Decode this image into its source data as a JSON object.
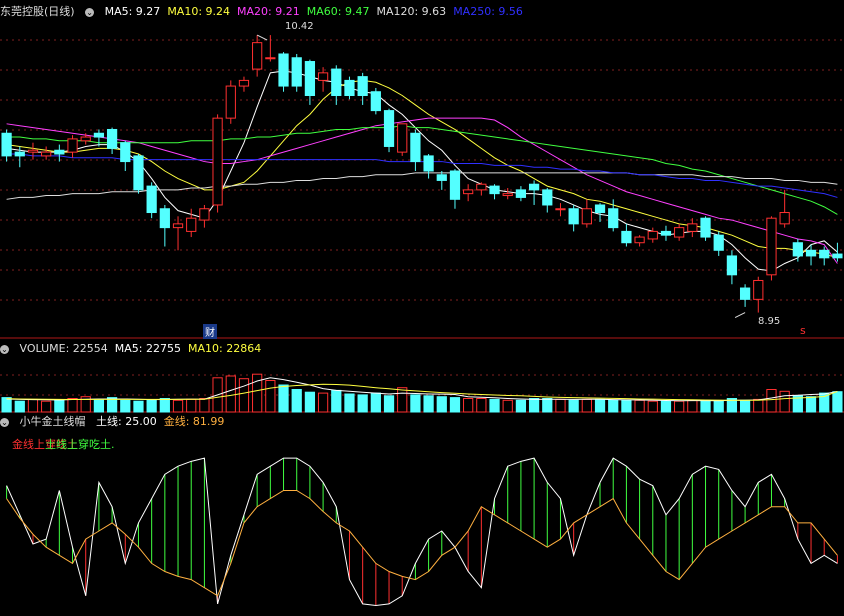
{
  "main": {
    "title": "东莞控股(日线)",
    "ma": [
      {
        "label": "MA5: 9.27",
        "color": "#ffffff"
      },
      {
        "label": "MA10: 9.24",
        "color": "#ffff40"
      },
      {
        "label": "MA20: 9.21",
        "color": "#ff40ff"
      },
      {
        "label": "MA60: 9.47",
        "color": "#40ff40"
      },
      {
        "label": "MA120: 9.63",
        "color": "#dddddd"
      },
      {
        "label": "MA250: 9.56",
        "color": "#3030ff"
      }
    ],
    "high_label": "10.42",
    "low_label": "8.95",
    "fin_badge": "财",
    "marker_s": "s"
  },
  "volume_panel": {
    "labels": [
      {
        "label": "VOLUME: 22554",
        "color": "#dddddd"
      },
      {
        "label": "MA5: 22755",
        "color": "#ffffff"
      },
      {
        "label": "MA10: 22864",
        "color": "#ffff40"
      }
    ]
  },
  "indicator_panel": {
    "name": "小牛金土线帽",
    "labels": [
      {
        "label": "土线: 25.00",
        "color": "#ffffff"
      },
      {
        "label": "金线: 81.99",
        "color": "#ffb040"
      }
    ],
    "signal_red": "金线上穿吃土",
    "signal_green": "土线上穿吃土."
  },
  "chart_data": {
    "type": "candlestick",
    "price_range": [
      8.9,
      10.5
    ],
    "candles": [
      [
        9.9,
        9.78,
        9.92,
        9.75
      ],
      [
        9.8,
        9.78,
        9.83,
        9.72
      ],
      [
        9.8,
        9.81,
        9.85,
        9.76
      ],
      [
        9.78,
        9.8,
        9.83,
        9.76
      ],
      [
        9.81,
        9.79,
        9.84,
        9.75
      ],
      [
        9.8,
        9.87,
        9.89,
        9.77
      ],
      [
        9.86,
        9.88,
        9.9,
        9.84
      ],
      [
        9.9,
        9.88,
        9.92,
        9.83
      ],
      [
        9.92,
        9.82,
        9.93,
        9.79
      ],
      [
        9.85,
        9.75,
        9.86,
        9.7
      ],
      [
        9.78,
        9.6,
        9.79,
        9.58
      ],
      [
        9.62,
        9.48,
        9.64,
        9.45
      ],
      [
        9.5,
        9.4,
        9.52,
        9.3
      ],
      [
        9.4,
        9.42,
        9.46,
        9.28
      ],
      [
        9.38,
        9.45,
        9.5,
        9.35
      ],
      [
        9.44,
        9.5,
        9.52,
        9.4
      ],
      [
        9.52,
        9.98,
        10.0,
        9.48
      ],
      [
        9.98,
        10.15,
        10.18,
        9.95
      ],
      [
        10.15,
        10.18,
        10.2,
        10.12
      ],
      [
        10.24,
        10.38,
        10.42,
        10.2
      ],
      [
        10.3,
        10.3,
        10.42,
        10.28
      ],
      [
        10.32,
        10.15,
        10.33,
        10.12
      ],
      [
        10.3,
        10.15,
        10.32,
        10.12
      ],
      [
        10.28,
        10.1,
        10.29,
        10.05
      ],
      [
        10.18,
        10.22,
        10.25,
        10.12
      ],
      [
        10.24,
        10.1,
        10.26,
        10.05
      ],
      [
        10.18,
        10.1,
        10.2,
        10.08
      ],
      [
        10.2,
        10.1,
        10.22,
        10.05
      ],
      [
        10.12,
        10.02,
        10.14,
        10.0
      ],
      [
        10.02,
        9.83,
        10.03,
        9.8
      ],
      [
        9.8,
        9.95,
        9.95,
        9.78
      ],
      [
        9.9,
        9.75,
        9.92,
        9.7
      ],
      [
        9.78,
        9.7,
        9.79,
        9.66
      ],
      [
        9.68,
        9.65,
        9.7,
        9.6
      ],
      [
        9.7,
        9.55,
        9.71,
        9.5
      ],
      [
        9.58,
        9.6,
        9.63,
        9.54
      ],
      [
        9.6,
        9.63,
        9.64,
        9.57
      ],
      [
        9.62,
        9.58,
        9.63,
        9.55
      ],
      [
        9.57,
        9.58,
        9.61,
        9.55
      ],
      [
        9.6,
        9.56,
        9.62,
        9.54
      ],
      [
        9.63,
        9.6,
        9.65,
        9.52
      ],
      [
        9.6,
        9.52,
        9.61,
        9.48
      ],
      [
        9.5,
        9.5,
        9.53,
        9.46
      ],
      [
        9.5,
        9.42,
        9.52,
        9.38
      ],
      [
        9.42,
        9.5,
        9.55,
        9.4
      ],
      [
        9.52,
        9.48,
        9.53,
        9.43
      ],
      [
        9.5,
        9.4,
        9.55,
        9.38
      ],
      [
        9.38,
        9.32,
        9.42,
        9.3
      ],
      [
        9.32,
        9.35,
        9.36,
        9.3
      ],
      [
        9.34,
        9.38,
        9.4,
        9.32
      ],
      [
        9.38,
        9.36,
        9.41,
        9.33
      ],
      [
        9.35,
        9.4,
        9.42,
        9.33
      ],
      [
        9.38,
        9.42,
        9.45,
        9.35
      ],
      [
        9.45,
        9.35,
        9.46,
        9.33
      ],
      [
        9.36,
        9.28,
        9.38,
        9.25
      ],
      [
        9.25,
        9.15,
        9.28,
        9.1
      ],
      [
        9.08,
        9.02,
        9.1,
        8.98
      ],
      [
        9.02,
        9.12,
        9.14,
        8.95
      ],
      [
        9.15,
        9.45,
        9.46,
        9.12
      ],
      [
        9.42,
        9.48,
        9.6,
        9.4
      ],
      [
        9.32,
        9.25,
        9.34,
        9.22
      ],
      [
        9.28,
        9.25,
        9.31,
        9.2
      ],
      [
        9.28,
        9.24,
        9.3,
        9.2
      ],
      [
        9.26,
        9.24,
        9.32,
        9.22
      ]
    ],
    "ma_lines": [
      {
        "name": "MA5",
        "color": "#ffffff",
        "values": [
          9.82,
          9.81,
          9.8,
          9.8,
          9.8,
          9.81,
          9.83,
          9.84,
          9.84,
          9.8,
          9.75,
          9.66,
          9.56,
          9.49,
          9.47,
          9.45,
          9.55,
          9.7,
          9.85,
          10.04,
          10.22,
          10.23,
          10.22,
          10.2,
          10.18,
          10.17,
          10.14,
          10.12,
          10.11,
          10.05,
          10.0,
          9.93,
          9.86,
          9.81,
          9.73,
          9.66,
          9.63,
          9.6,
          9.59,
          9.58,
          9.58,
          9.57,
          9.55,
          9.52,
          9.49,
          9.47,
          9.46,
          9.42,
          9.4,
          9.38,
          9.36,
          9.37,
          9.38,
          9.38,
          9.36,
          9.31,
          9.24,
          9.18,
          9.17,
          9.21,
          9.24,
          9.31,
          9.33,
          9.27
        ]
      },
      {
        "name": "MA10",
        "color": "#ffff40",
        "values": [
          9.84,
          9.83,
          9.82,
          9.81,
          9.8,
          9.8,
          9.81,
          9.82,
          9.82,
          9.81,
          9.79,
          9.75,
          9.7,
          9.66,
          9.63,
          9.6,
          9.6,
          9.62,
          9.64,
          9.7,
          9.78,
          9.86,
          9.94,
          10.0,
          10.08,
          10.14,
          10.17,
          10.18,
          10.17,
          10.14,
          10.1,
          10.05,
          10.0,
          9.96,
          9.92,
          9.87,
          9.82,
          9.77,
          9.73,
          9.7,
          9.66,
          9.62,
          9.6,
          9.58,
          9.55,
          9.54,
          9.52,
          9.5,
          9.48,
          9.46,
          9.44,
          9.42,
          9.41,
          9.4,
          9.38,
          9.36,
          9.33,
          9.3,
          9.29,
          9.29,
          9.28,
          9.27,
          9.26,
          9.24
        ]
      },
      {
        "name": "MA20",
        "color": "#ff40ff",
        "values": [
          9.95,
          9.94,
          9.93,
          9.92,
          9.91,
          9.9,
          9.89,
          9.88,
          9.87,
          9.86,
          9.85,
          9.83,
          9.81,
          9.79,
          9.77,
          9.75,
          9.74,
          9.74,
          9.75,
          9.76,
          9.78,
          9.8,
          9.82,
          9.84,
          9.86,
          9.88,
          9.9,
          9.92,
          9.94,
          9.95,
          9.96,
          9.97,
          9.98,
          9.98,
          9.98,
          9.98,
          9.98,
          9.97,
          9.93,
          9.88,
          9.84,
          9.8,
          9.76,
          9.72,
          9.68,
          9.65,
          9.62,
          9.59,
          9.57,
          9.55,
          9.53,
          9.51,
          9.49,
          9.47,
          9.45,
          9.44,
          9.42,
          9.4,
          9.38,
          9.36,
          9.34,
          9.33,
          9.31,
          9.21
        ]
      },
      {
        "name": "MA60",
        "color": "#40ff40",
        "values": [
          9.88,
          9.88,
          9.87,
          9.87,
          9.86,
          9.86,
          9.86,
          9.85,
          9.85,
          9.85,
          9.85,
          9.85,
          9.85,
          9.85,
          9.86,
          9.86,
          9.86,
          9.87,
          9.87,
          9.88,
          9.88,
          9.89,
          9.9,
          9.9,
          9.91,
          9.92,
          9.92,
          9.93,
          9.93,
          9.93,
          9.94,
          9.93,
          9.93,
          9.92,
          9.91,
          9.9,
          9.89,
          9.88,
          9.87,
          9.86,
          9.85,
          9.84,
          9.83,
          9.82,
          9.81,
          9.8,
          9.79,
          9.78,
          9.77,
          9.76,
          9.74,
          9.73,
          9.71,
          9.7,
          9.68,
          9.66,
          9.64,
          9.62,
          9.6,
          9.58,
          9.56,
          9.54,
          9.51,
          9.47
        ]
      },
      {
        "name": "MA120",
        "color": "#dddddd",
        "values": [
          9.55,
          9.56,
          9.56,
          9.57,
          9.57,
          9.58,
          9.58,
          9.58,
          9.59,
          9.59,
          9.59,
          9.6,
          9.6,
          9.6,
          9.61,
          9.61,
          9.62,
          9.62,
          9.63,
          9.63,
          9.64,
          9.64,
          9.65,
          9.65,
          9.66,
          9.66,
          9.67,
          9.67,
          9.68,
          9.68,
          9.68,
          9.69,
          9.69,
          9.69,
          9.69,
          9.69,
          9.69,
          9.69,
          9.69,
          9.69,
          9.69,
          9.69,
          9.69,
          9.69,
          9.69,
          9.69,
          9.69,
          9.69,
          9.68,
          9.68,
          9.68,
          9.68,
          9.68,
          9.67,
          9.67,
          9.67,
          9.66,
          9.66,
          9.66,
          9.65,
          9.65,
          9.64,
          9.64,
          9.63
        ]
      },
      {
        "name": "MA250",
        "color": "#3030ff",
        "values": [
          9.79,
          9.79,
          9.78,
          9.78,
          9.78,
          9.77,
          9.77,
          9.77,
          9.77,
          9.76,
          9.76,
          9.76,
          9.76,
          9.76,
          9.76,
          9.76,
          9.76,
          9.76,
          9.76,
          9.76,
          9.76,
          9.76,
          9.76,
          9.76,
          9.76,
          9.76,
          9.76,
          9.76,
          9.76,
          9.75,
          9.75,
          9.75,
          9.75,
          9.75,
          9.74,
          9.74,
          9.74,
          9.73,
          9.73,
          9.73,
          9.72,
          9.72,
          9.71,
          9.71,
          9.7,
          9.7,
          9.69,
          9.69,
          9.68,
          9.68,
          9.67,
          9.66,
          9.66,
          9.65,
          9.65,
          9.64,
          9.63,
          9.62,
          9.62,
          9.61,
          9.6,
          9.59,
          9.58,
          9.56
        ]
      }
    ],
    "volume": {
      "range": [
        0,
        60000
      ],
      "values": [
        16000,
        12000,
        14000,
        12000,
        13000,
        15000,
        17000,
        14000,
        16000,
        13000,
        12000,
        13000,
        15000,
        13000,
        14000,
        15000,
        38000,
        40000,
        37000,
        42000,
        35000,
        30000,
        25000,
        22000,
        21000,
        24000,
        20000,
        19000,
        21000,
        18000,
        27000,
        19000,
        18000,
        17000,
        16000,
        15000,
        15000,
        14000,
        13000,
        13000,
        15000,
        15000,
        14000,
        13000,
        14000,
        14000,
        13000,
        13000,
        13000,
        12000,
        12000,
        12000,
        13000,
        13000,
        12000,
        15000,
        13000,
        14000,
        25000,
        23000,
        18000,
        17000,
        21000,
        22554
      ],
      "ma5": [
        14500,
        14000,
        13800,
        13600,
        13400,
        13900,
        14200,
        14400,
        14500,
        14500,
        14200,
        13800,
        13900,
        14100,
        14300,
        14200,
        19000,
        24000,
        28800,
        34400,
        38000,
        36000,
        33000,
        30000,
        26000,
        24000,
        23000,
        22000,
        21000,
        20000,
        21000,
        20500,
        20000,
        19800,
        19500,
        17000,
        16400,
        15800,
        15000,
        14400,
        14000,
        14200,
        14200,
        14000,
        14200,
        14200,
        13800,
        13500,
        13400,
        13200,
        12800,
        12500,
        12600,
        12700,
        12500,
        13000,
        13000,
        13500,
        15500,
        18000,
        18600,
        19400,
        20000,
        22755
      ],
      "ma10": [
        14800,
        14500,
        14300,
        14100,
        14000,
        13900,
        13900,
        14000,
        14000,
        14000,
        14000,
        14000,
        14000,
        14000,
        14100,
        14100,
        16400,
        18500,
        21000,
        23800,
        26500,
        28400,
        29500,
        30200,
        30800,
        30500,
        29800,
        28500,
        27000,
        25800,
        24500,
        23500,
        22500,
        21500,
        20800,
        20000,
        19400,
        18900,
        18400,
        18000,
        17300,
        16700,
        16300,
        16000,
        15700,
        15400,
        15100,
        14800,
        14500,
        14300,
        14000,
        13800,
        13600,
        13400,
        13200,
        13000,
        13000,
        13100,
        13800,
        14800,
        15500,
        16300,
        17200,
        22864
      ]
    },
    "indicator": {
      "range": [
        0,
        100
      ],
      "gold_level": 81.99,
      "earth_level": 25.0,
      "white": [
        78,
        60,
        42,
        45,
        75,
        40,
        10,
        80,
        65,
        30,
        55,
        70,
        85,
        90,
        93,
        95,
        5,
        35,
        60,
        85,
        90,
        95,
        95,
        90,
        80,
        65,
        20,
        5,
        4,
        5,
        10,
        30,
        45,
        50,
        40,
        25,
        15,
        70,
        90,
        93,
        95,
        80,
        70,
        35,
        60,
        80,
        95,
        90,
        82,
        78,
        60,
        70,
        85,
        90,
        88,
        75,
        65,
        80,
        85,
        70,
        45,
        30,
        35,
        30
      ],
      "gold": [
        70,
        58,
        48,
        40,
        35,
        30,
        45,
        50,
        55,
        48,
        40,
        30,
        25,
        22,
        20,
        15,
        10,
        30,
        55,
        65,
        70,
        75,
        75,
        70,
        62,
        55,
        50,
        40,
        30,
        25,
        22,
        20,
        25,
        35,
        40,
        50,
        65,
        60,
        55,
        50,
        45,
        40,
        45,
        55,
        60,
        65,
        70,
        55,
        45,
        35,
        25,
        20,
        30,
        40,
        45,
        50,
        55,
        60,
        65,
        65,
        55,
        55,
        45,
        35
      ]
    }
  }
}
